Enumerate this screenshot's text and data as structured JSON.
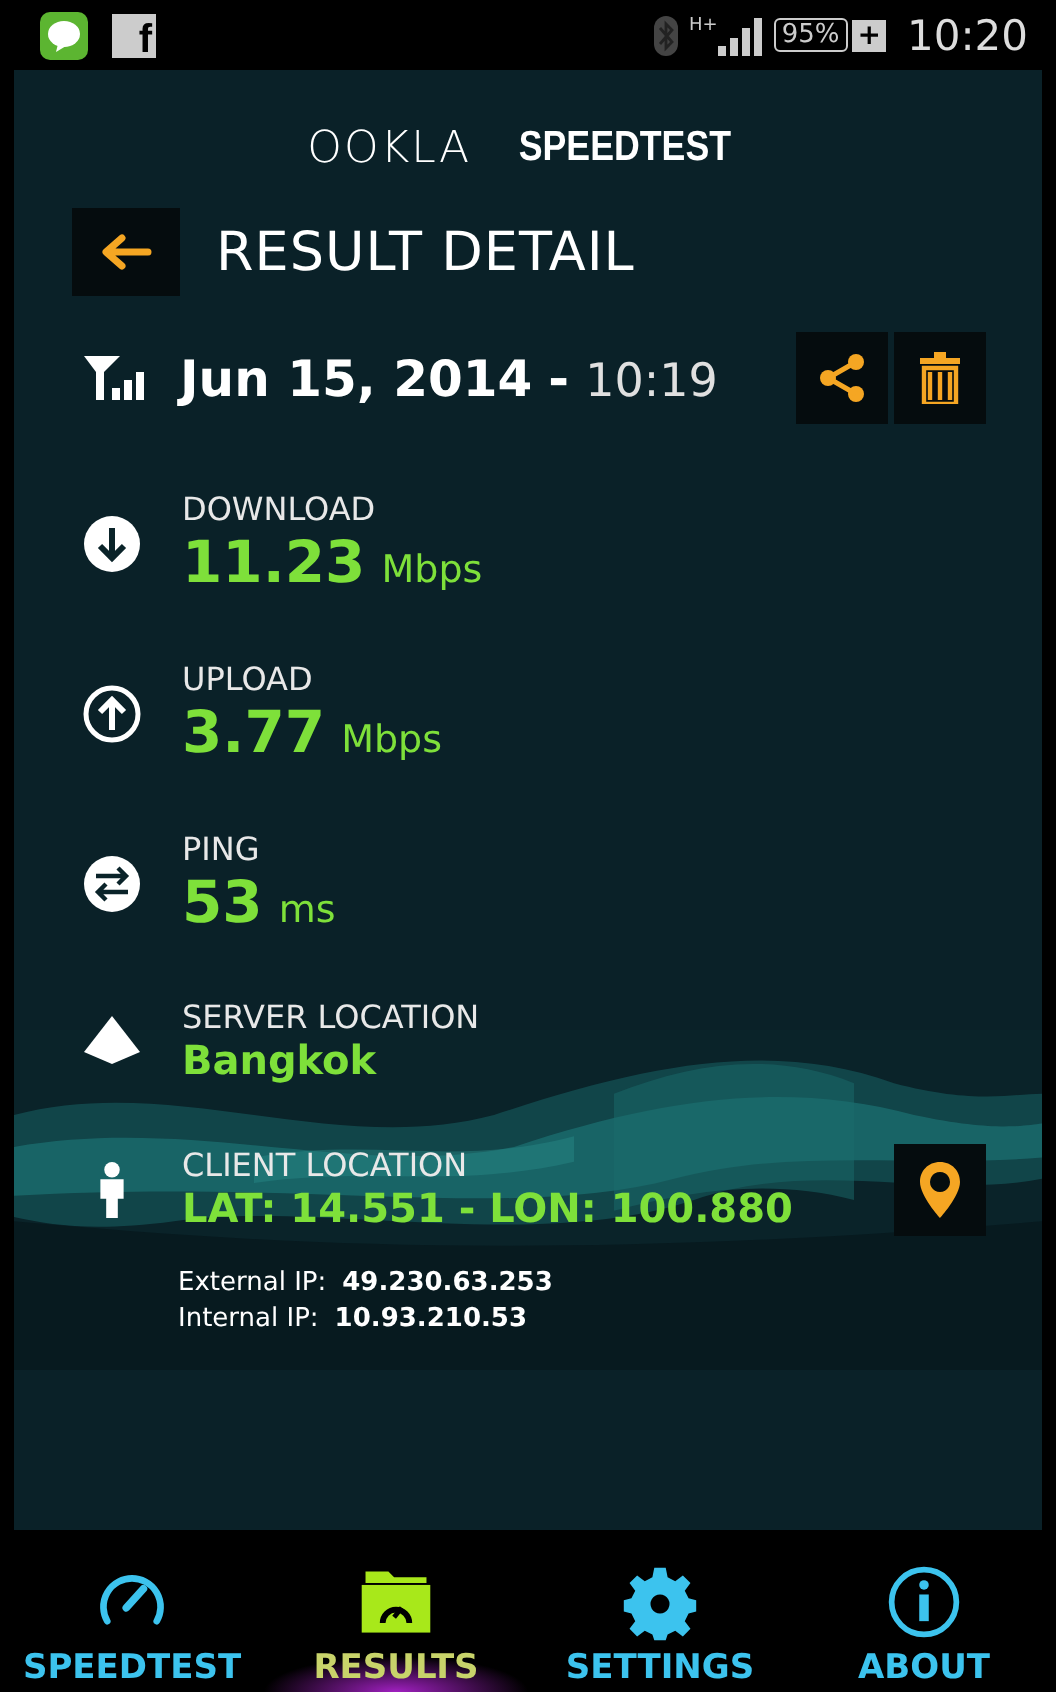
{
  "status_bar": {
    "facebook_letter": "f",
    "network": "H+",
    "battery": "95%",
    "charging": "+",
    "time": "10:20"
  },
  "logo": {
    "brand": "OOKLA",
    "product": "SPEEDTEST"
  },
  "header": {
    "title": "RESULT DETAIL"
  },
  "result": {
    "date": "Jun 15, 2014",
    "separator": "-",
    "time": "10:19"
  },
  "metrics": [
    {
      "kind": "download",
      "label": "DOWNLOAD",
      "value": "11.23",
      "unit": "Mbps"
    },
    {
      "kind": "upload",
      "label": "UPLOAD",
      "value": "3.77",
      "unit": "Mbps"
    },
    {
      "kind": "ping",
      "label": "PING",
      "value": "53",
      "unit": "ms"
    },
    {
      "kind": "server",
      "label": "SERVER LOCATION",
      "value": "Bangkok"
    },
    {
      "kind": "client",
      "label": "CLIENT LOCATION",
      "value": "LAT: 14.551 - LON: 100.880"
    }
  ],
  "ip": [
    {
      "label": "External IP:",
      "value": "49.230.63.253"
    },
    {
      "label": "Internal IP:",
      "value": "10.93.210.53"
    }
  ],
  "nav": [
    {
      "kind": "gauge",
      "label": "SPEEDTEST",
      "selected": false
    },
    {
      "kind": "folder",
      "label": "RESULTS",
      "selected": true
    },
    {
      "kind": "gear",
      "label": "SETTINGS",
      "selected": false
    },
    {
      "kind": "info",
      "label": "ABOUT",
      "selected": false
    }
  ]
}
